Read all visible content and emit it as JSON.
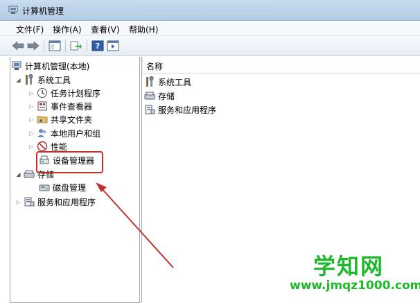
{
  "window": {
    "title": "计算机管理",
    "icon": "computer-management-icon"
  },
  "menu": [
    {
      "label": "文件(F)"
    },
    {
      "label": "操作(A)"
    },
    {
      "label": "查看(V)"
    },
    {
      "label": "帮助(H)"
    }
  ],
  "toolbar": {
    "buttons": [
      "back-arrow-icon",
      "forward-arrow-icon",
      "show-hide-tree-icon",
      "export-list-icon",
      "help-icon",
      "properties-icon"
    ]
  },
  "tree": {
    "root": {
      "label": "计算机管理(本地)",
      "icon": "computer-management-icon"
    },
    "items": [
      {
        "label": "系统工具",
        "icon": "tools-icon",
        "expanded": true
      },
      {
        "label": "任务计划程序",
        "icon": "clock-icon"
      },
      {
        "label": "事件查看器",
        "icon": "event-viewer-icon"
      },
      {
        "label": "共享文件夹",
        "icon": "shared-folder-icon"
      },
      {
        "label": "本地用户和组",
        "icon": "users-icon"
      },
      {
        "label": "性能",
        "icon": "performance-icon"
      },
      {
        "label": "设备管理器",
        "icon": "device-manager-icon"
      },
      {
        "label": "存储",
        "icon": "storage-icon",
        "expanded": true
      },
      {
        "label": "磁盘管理",
        "icon": "disk-icon"
      },
      {
        "label": "服务和应用程序",
        "icon": "services-icon"
      }
    ]
  },
  "list": {
    "column_header": "名称",
    "items": [
      {
        "label": "系统工具",
        "icon": "tools-icon"
      },
      {
        "label": "存储",
        "icon": "storage-icon"
      },
      {
        "label": "服务和应用程序",
        "icon": "services-icon"
      }
    ]
  },
  "watermark": {
    "title": "学知网",
    "url": "www.jmqz1000.com"
  },
  "colors": {
    "annotation": "#c0312f",
    "watermark": "#1fb82c"
  }
}
